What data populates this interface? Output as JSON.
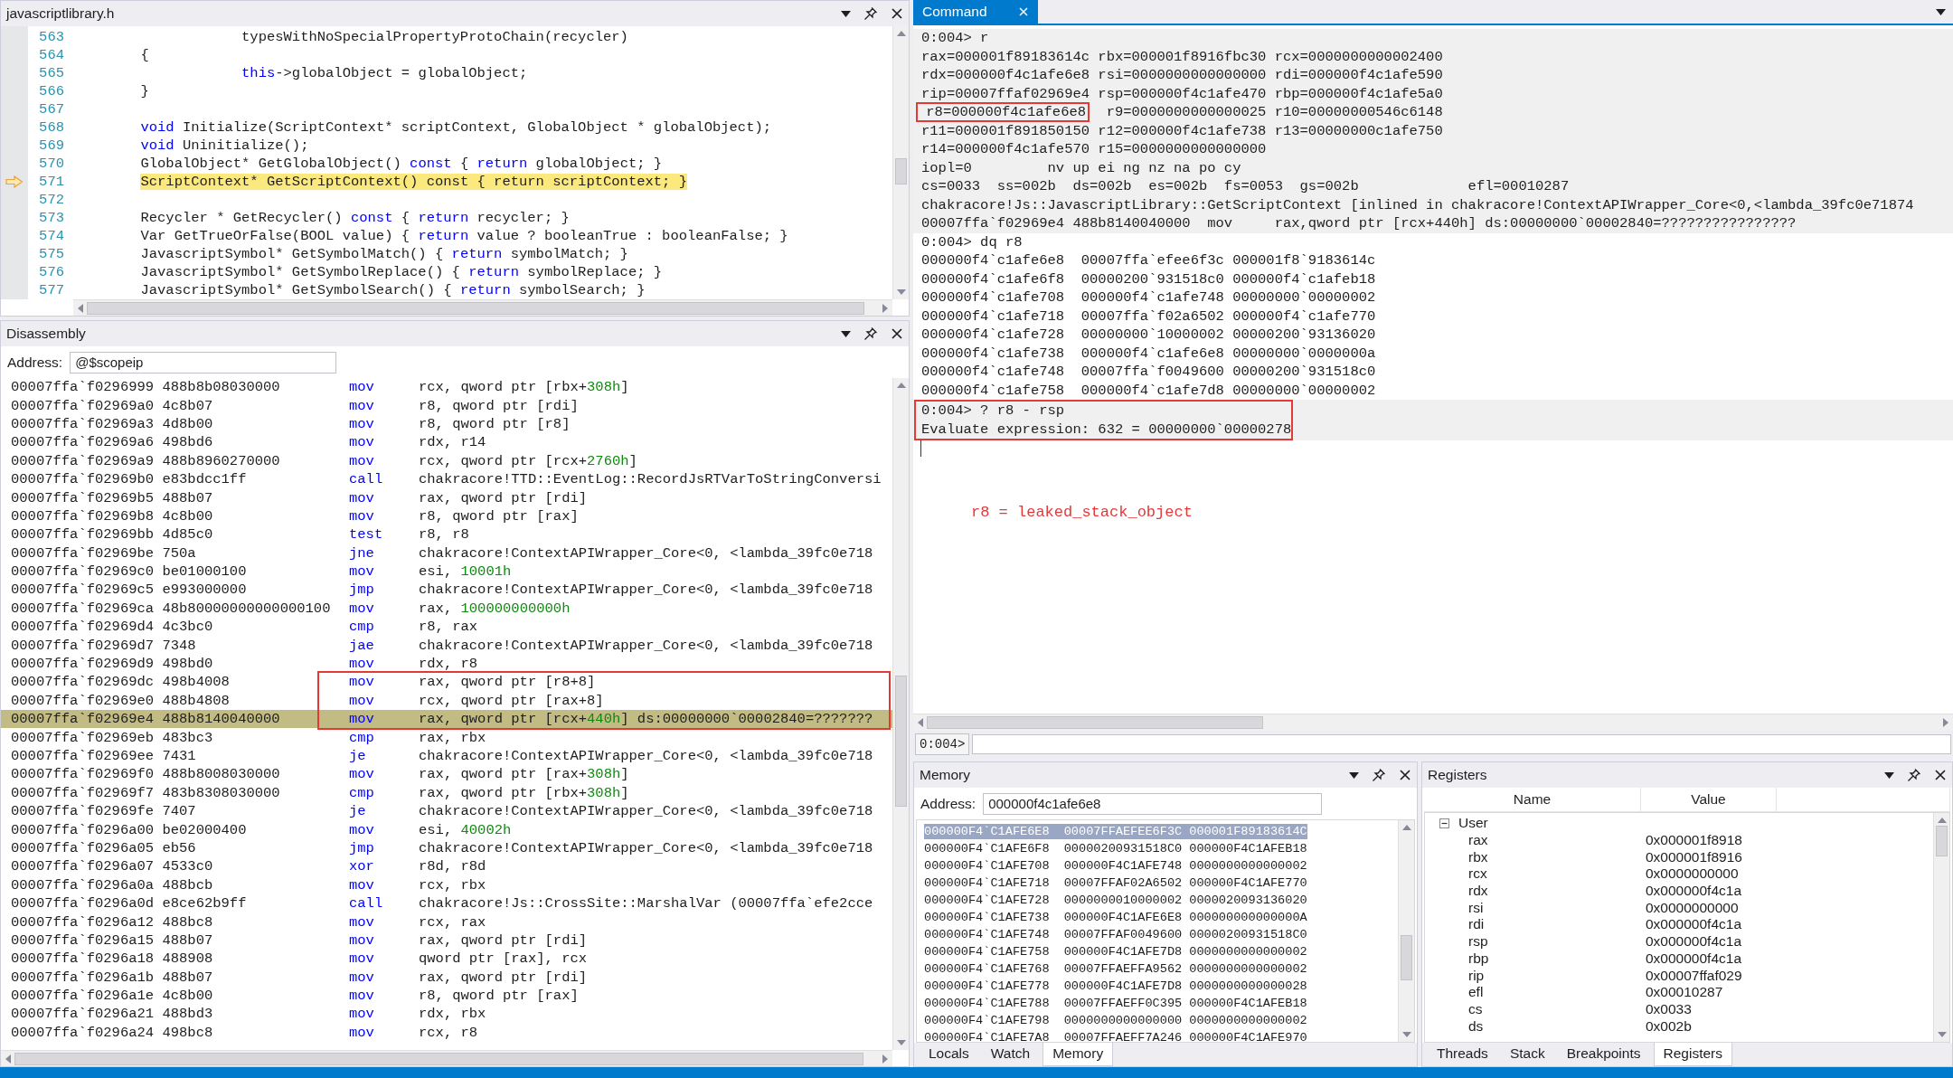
{
  "source": {
    "title": "javascriptlibrary.h",
    "lines": [
      {
        "number": "563",
        "current": false,
        "segments": [
          {
            "text": "                    typesWithNoSpecialPropertyProtoChain(recycler)",
            "kind": "plain"
          }
        ]
      },
      {
        "number": "564",
        "current": false,
        "segments": [
          {
            "text": "        {",
            "kind": "plain"
          }
        ]
      },
      {
        "number": "565",
        "current": false,
        "segments": [
          {
            "text": "                    this",
            "kind": "keyword"
          },
          {
            "text": "->globalObject = globalObject;",
            "kind": "plain"
          }
        ]
      },
      {
        "number": "566",
        "current": false,
        "segments": [
          {
            "text": "        }",
            "kind": "plain"
          }
        ]
      },
      {
        "number": "567",
        "current": false
      },
      {
        "number": "568",
        "current": false,
        "segments": [
          {
            "text": "        void",
            "kind": "keyword"
          },
          {
            "text": " Initialize(ScriptContext* scriptContext, GlobalObject * globalObject);",
            "kind": "plain"
          }
        ]
      },
      {
        "number": "569",
        "current": false,
        "segments": [
          {
            "text": "        void",
            "kind": "keyword"
          },
          {
            "text": " Uninitialize();",
            "kind": "plain"
          }
        ]
      },
      {
        "number": "570",
        "current": false,
        "segments": [
          {
            "text": "        GlobalObject* GetGlobalObject() ",
            "kind": "plain"
          },
          {
            "text": "const",
            "kind": "keyword"
          },
          {
            "text": " { ",
            "kind": "plain"
          },
          {
            "text": "return",
            "kind": "keyword"
          },
          {
            "text": " globalObject; }",
            "kind": "plain"
          }
        ]
      },
      {
        "number": "571",
        "current": true,
        "segments": [
          {
            "text": "        ScriptContext* GetScriptContext() const { return scriptContext; }",
            "kind": "plain"
          }
        ]
      },
      {
        "number": "572",
        "current": false
      },
      {
        "number": "573",
        "current": false,
        "segments": [
          {
            "text": "        Recycler * GetRecycler() ",
            "kind": "plain"
          },
          {
            "text": "const",
            "kind": "keyword"
          },
          {
            "text": " { ",
            "kind": "plain"
          },
          {
            "text": "return",
            "kind": "keyword"
          },
          {
            "text": " recycler; }",
            "kind": "plain"
          }
        ]
      },
      {
        "number": "574",
        "current": false,
        "segments": [
          {
            "text": "        Var GetTrueOrFalse(BOOL value) { ",
            "kind": "plain"
          },
          {
            "text": "return",
            "kind": "keyword"
          },
          {
            "text": " value ? booleanTrue : booleanFalse; }",
            "kind": "plain"
          }
        ]
      },
      {
        "number": "575",
        "current": false,
        "segments": [
          {
            "text": "        JavascriptSymbol* GetSymbolMatch() { ",
            "kind": "plain"
          },
          {
            "text": "return",
            "kind": "keyword"
          },
          {
            "text": " symbolMatch; }",
            "kind": "plain"
          }
        ]
      },
      {
        "number": "576",
        "current": false,
        "segments": [
          {
            "text": "        JavascriptSymbol* GetSymbolReplace() { ",
            "kind": "plain"
          },
          {
            "text": "return",
            "kind": "keyword"
          },
          {
            "text": " symbolReplace; }",
            "kind": "plain"
          }
        ]
      },
      {
        "number": "577",
        "current": false,
        "segments": [
          {
            "text": "        JavascriptSymbol* GetSymbolSearch() { ",
            "kind": "plain"
          },
          {
            "text": "return",
            "kind": "keyword"
          },
          {
            "text": " symbolSearch; }",
            "kind": "plain"
          }
        ]
      }
    ]
  },
  "disassembly": {
    "title": "Disassembly",
    "address_label": "Address:",
    "address": "@$scopeip",
    "rows": [
      {
        "address": "00007ffa`f0296999",
        "bytes": "488b8b08030000",
        "mnemonic": "mov",
        "operands": [
          {
            "text": "rcx, qword ptr [rbx+",
            "kind": "plain"
          },
          {
            "text": "308h",
            "kind": "number"
          },
          {
            "text": "]",
            "kind": "plain"
          }
        ],
        "current": false,
        "boxed": false
      },
      {
        "address": "00007ffa`f02969a0",
        "bytes": "4c8b07",
        "mnemonic": "mov",
        "operands": [
          {
            "text": "r8, qword ptr [rdi]",
            "kind": "plain"
          }
        ],
        "current": false,
        "boxed": false
      },
      {
        "address": "00007ffa`f02969a3",
        "bytes": "4d8b00",
        "mnemonic": "mov",
        "operands": [
          {
            "text": "r8, qword ptr [r8]",
            "kind": "plain"
          }
        ],
        "current": false,
        "boxed": false
      },
      {
        "address": "00007ffa`f02969a6",
        "bytes": "498bd6",
        "mnemonic": "mov",
        "operands": [
          {
            "text": "rdx, r14",
            "kind": "plain"
          }
        ],
        "current": false,
        "boxed": false
      },
      {
        "address": "00007ffa`f02969a9",
        "bytes": "488b8960270000",
        "mnemonic": "mov",
        "operands": [
          {
            "text": "rcx, qword ptr [rcx+",
            "kind": "plain"
          },
          {
            "text": "2760h",
            "kind": "number"
          },
          {
            "text": "]",
            "kind": "plain"
          }
        ],
        "current": false,
        "boxed": false
      },
      {
        "address": "00007ffa`f02969b0",
        "bytes": "e83bdcc1ff",
        "mnemonic": "call",
        "operands": [
          {
            "text": "chakracore!TTD::EventLog::RecordJsRTVarToStringConversi",
            "kind": "plain"
          }
        ],
        "current": false,
        "boxed": false
      },
      {
        "address": "00007ffa`f02969b5",
        "bytes": "488b07",
        "mnemonic": "mov",
        "operands": [
          {
            "text": "rax, qword ptr [rdi]",
            "kind": "plain"
          }
        ],
        "current": false,
        "boxed": false
      },
      {
        "address": "00007ffa`f02969b8",
        "bytes": "4c8b00",
        "mnemonic": "mov",
        "operands": [
          {
            "text": "r8, qword ptr [rax]",
            "kind": "plain"
          }
        ],
        "current": false,
        "boxed": false
      },
      {
        "address": "00007ffa`f02969bb",
        "bytes": "4d85c0",
        "mnemonic": "test",
        "operands": [
          {
            "text": "r8, r8",
            "kind": "plain"
          }
        ],
        "current": false,
        "boxed": false
      },
      {
        "address": "00007ffa`f02969be",
        "bytes": "750a",
        "mnemonic": "jne",
        "operands": [
          {
            "text": "chakracore!ContextAPIWrapper_Core<0, <lambda_39fc0e718",
            "kind": "plain"
          }
        ],
        "current": false,
        "boxed": false
      },
      {
        "address": "00007ffa`f02969c0",
        "bytes": "be01000100",
        "mnemonic": "mov",
        "operands": [
          {
            "text": "esi, ",
            "kind": "plain"
          },
          {
            "text": "10001h",
            "kind": "number"
          }
        ],
        "current": false,
        "boxed": false
      },
      {
        "address": "00007ffa`f02969c5",
        "bytes": "e993000000",
        "mnemonic": "jmp",
        "operands": [
          {
            "text": "chakracore!ContextAPIWrapper_Core<0, <lambda_39fc0e718",
            "kind": "plain"
          }
        ],
        "current": false,
        "boxed": false
      },
      {
        "address": "00007ffa`f02969ca",
        "bytes": "48b80000000000000100",
        "mnemonic": "mov",
        "operands": [
          {
            "text": "rax, ",
            "kind": "plain"
          },
          {
            "text": "100000000000h",
            "kind": "number"
          }
        ],
        "current": false,
        "boxed": false
      },
      {
        "address": "00007ffa`f02969d4",
        "bytes": "4c3bc0",
        "mnemonic": "cmp",
        "operands": [
          {
            "text": "r8, rax",
            "kind": "plain"
          }
        ],
        "current": false,
        "boxed": false
      },
      {
        "address": "00007ffa`f02969d7",
        "bytes": "7348",
        "mnemonic": "jae",
        "operands": [
          {
            "text": "chakracore!ContextAPIWrapper_Core<0, <lambda_39fc0e718",
            "kind": "plain"
          }
        ],
        "current": false,
        "boxed": false
      },
      {
        "address": "00007ffa`f02969d9",
        "bytes": "498bd0",
        "mnemonic": "mov",
        "operands": [
          {
            "text": "rdx, r8",
            "kind": "plain"
          }
        ],
        "current": false,
        "boxed": false
      },
      {
        "address": "00007ffa`f02969dc",
        "bytes": "498b4008",
        "mnemonic": "mov",
        "operands": [
          {
            "text": "rax, qword ptr [r8+8]",
            "kind": "plain"
          }
        ],
        "current": false,
        "boxed": true
      },
      {
        "address": "00007ffa`f02969e0",
        "bytes": "488b4808",
        "mnemonic": "mov",
        "operands": [
          {
            "text": "rcx, qword ptr [rax+8]",
            "kind": "plain"
          }
        ],
        "current": false,
        "boxed": true
      },
      {
        "address": "00007ffa`f02969e4",
        "bytes": "488b8140040000",
        "mnemonic": "mov",
        "operands": [
          {
            "text": "rax, qword ptr [rcx+",
            "kind": "plain"
          },
          {
            "text": "440h",
            "kind": "number"
          },
          {
            "text": "] ds:00000000`00002840=???????",
            "kind": "plain"
          }
        ],
        "current": true,
        "boxed": true
      },
      {
        "address": "00007ffa`f02969eb",
        "bytes": "483bc3",
        "mnemonic": "cmp",
        "operands": [
          {
            "text": "rax, rbx",
            "kind": "plain"
          }
        ],
        "current": false,
        "boxed": false
      },
      {
        "address": "00007ffa`f02969ee",
        "bytes": "7431",
        "mnemonic": "je",
        "operands": [
          {
            "text": "chakracore!ContextAPIWrapper_Core<0, <lambda_39fc0e718",
            "kind": "plain"
          }
        ],
        "current": false,
        "boxed": false
      },
      {
        "address": "00007ffa`f02969f0",
        "bytes": "488b8008030000",
        "mnemonic": "mov",
        "operands": [
          {
            "text": "rax, qword ptr [rax+",
            "kind": "plain"
          },
          {
            "text": "308h",
            "kind": "number"
          },
          {
            "text": "]",
            "kind": "plain"
          }
        ],
        "current": false,
        "boxed": false
      },
      {
        "address": "00007ffa`f02969f7",
        "bytes": "483b8308030000",
        "mnemonic": "cmp",
        "operands": [
          {
            "text": "rax, qword ptr [rbx+",
            "kind": "plain"
          },
          {
            "text": "308h",
            "kind": "number"
          },
          {
            "text": "]",
            "kind": "plain"
          }
        ],
        "current": false,
        "boxed": false
      },
      {
        "address": "00007ffa`f02969fe",
        "bytes": "7407",
        "mnemonic": "je",
        "operands": [
          {
            "text": "chakracore!ContextAPIWrapper_Core<0, <lambda_39fc0e718",
            "kind": "plain"
          }
        ],
        "current": false,
        "boxed": false
      },
      {
        "address": "00007ffa`f0296a00",
        "bytes": "be02000400",
        "mnemonic": "mov",
        "operands": [
          {
            "text": "esi, ",
            "kind": "plain"
          },
          {
            "text": "40002h",
            "kind": "number"
          }
        ],
        "current": false,
        "boxed": false
      },
      {
        "address": "00007ffa`f0296a05",
        "bytes": "eb56",
        "mnemonic": "jmp",
        "operands": [
          {
            "text": "chakracore!ContextAPIWrapper_Core<0, <lambda_39fc0e718",
            "kind": "plain"
          }
        ],
        "current": false,
        "boxed": false
      },
      {
        "address": "00007ffa`f0296a07",
        "bytes": "4533c0",
        "mnemonic": "xor",
        "operands": [
          {
            "text": "r8d, r8d",
            "kind": "plain"
          }
        ],
        "current": false,
        "boxed": false
      },
      {
        "address": "00007ffa`f0296a0a",
        "bytes": "488bcb",
        "mnemonic": "mov",
        "operands": [
          {
            "text": "rcx, rbx",
            "kind": "plain"
          }
        ],
        "current": false,
        "boxed": false
      },
      {
        "address": "00007ffa`f0296a0d",
        "bytes": "e8ce62b9ff",
        "mnemonic": "call",
        "operands": [
          {
            "text": "chakracore!Js::CrossSite::MarshalVar (00007ffa`efe2cce",
            "kind": "plain"
          }
        ],
        "current": false,
        "boxed": false
      },
      {
        "address": "00007ffa`f0296a12",
        "bytes": "488bc8",
        "mnemonic": "mov",
        "operands": [
          {
            "text": "rcx, rax",
            "kind": "plain"
          }
        ],
        "current": false,
        "boxed": false
      },
      {
        "address": "00007ffa`f0296a15",
        "bytes": "488b07",
        "mnemonic": "mov",
        "operands": [
          {
            "text": "rax, qword ptr [rdi]",
            "kind": "plain"
          }
        ],
        "current": false,
        "boxed": false
      },
      {
        "address": "00007ffa`f0296a18",
        "bytes": "488908",
        "mnemonic": "mov",
        "operands": [
          {
            "text": "qword ptr [rax], rcx",
            "kind": "plain"
          }
        ],
        "current": false,
        "boxed": false
      },
      {
        "address": "00007ffa`f0296a1b",
        "bytes": "488b07",
        "mnemonic": "mov",
        "operands": [
          {
            "text": "rax, qword ptr [rdi]",
            "kind": "plain"
          }
        ],
        "current": false,
        "boxed": false
      },
      {
        "address": "00007ffa`f0296a1e",
        "bytes": "4c8b00",
        "mnemonic": "mov",
        "operands": [
          {
            "text": "r8, qword ptr [rax]",
            "kind": "plain"
          }
        ],
        "current": false,
        "boxed": false
      },
      {
        "address": "00007ffa`f0296a21",
        "bytes": "488bd3",
        "mnemonic": "mov",
        "operands": [
          {
            "text": "rdx, rbx",
            "kind": "plain"
          }
        ],
        "current": false,
        "boxed": false
      },
      {
        "address": "00007ffa`f0296a24",
        "bytes": "498bc8",
        "mnemonic": "mov",
        "operands": [
          {
            "text": "rcx, r8",
            "kind": "plain"
          }
        ],
        "current": false,
        "boxed": false
      }
    ]
  },
  "command": {
    "tab": {
      "label": "Command",
      "selected": true
    },
    "blocks": [
      {
        "shaded": true,
        "boxed": false,
        "lines": [
          {
            "text": "0:004> r"
          },
          {
            "text": "rax=000001f89183614c rbx=000001f8916fbc30 rcx=0000000000002400"
          },
          {
            "text": "rdx=000000f4c1afe6e8 rsi=0000000000000000 rdi=000000f4c1afe590"
          },
          {
            "text": "rip=00007ffaf02969e4 rsp=000000f4c1afe470 rbp=000000f4c1afe5a0"
          },
          {
            "boxed": " r8=000000f4c1afe6e8",
            "text": "  r9=0000000000000025 r10=00000000546c6148"
          },
          {
            "text": "r11=000001f891850150 r12=000000f4c1afe738 r13=00000000c1afe750"
          },
          {
            "text": "r14=000000f4c1afe570 r15=0000000000000000"
          },
          {
            "text": "iopl=0         nv up ei ng nz na po cy"
          },
          {
            "text": "cs=0033  ss=002b  ds=002b  es=002b  fs=0053  gs=002b             efl=00010287"
          },
          {
            "text": "chakracore!Js::JavascriptLibrary::GetScriptContext [inlined in chakracore!ContextAPIWrapper_Core<0,<lambda_39fc0e71874"
          },
          {
            "text": "00007ffa`f02969e4 488b8140040000  mov     rax,qword ptr [rcx+440h] ds:00000000`00002840=????????????????"
          }
        ]
      },
      {
        "shaded": false,
        "boxed": false,
        "lines": [
          {
            "text": "0:004> dq r8"
          },
          {
            "text": "000000f4`c1afe6e8  00007ffa`efee6f3c 000001f8`9183614c"
          },
          {
            "text": "000000f4`c1afe6f8  00000200`931518c0 000000f4`c1afeb18"
          },
          {
            "text": "000000f4`c1afe708  000000f4`c1afe748 00000000`00000002"
          },
          {
            "text": "000000f4`c1afe718  00007ffa`f02a6502 000000f4`c1afe770"
          },
          {
            "text": "000000f4`c1afe728  00000000`10000002 00000200`93136020"
          },
          {
            "text": "000000f4`c1afe738  000000f4`c1afe6e8 00000000`0000000a"
          },
          {
            "text": "000000f4`c1afe748  00007ffa`f0049600 00000200`931518c0"
          },
          {
            "text": "000000f4`c1afe758  000000f4`c1afe7d8 00000000`00000002"
          }
        ]
      },
      {
        "shaded": true,
        "boxed": true,
        "lines": [
          {
            "text": "0:004> ? r8 - rsp"
          },
          {
            "text": "Evaluate expression: 632 = 00000000`00000278"
          }
        ]
      }
    ],
    "note": "r8 = leaked_stack_object",
    "prompt": "0:004>"
  },
  "memory": {
    "title": "Memory",
    "address_label": "Address:",
    "address": "000000f4c1afe6e8",
    "rows": [
      {
        "address": "000000F4`C1AFE6E8",
        "col_1": "00007FFAEFEE6F3C",
        "col_2": "000001F89183614C",
        "selected": true
      },
      {
        "address": "000000F4`C1AFE6F8",
        "col_1": "00000200931518C0",
        "col_2": "000000F4C1AFEB18",
        "selected": false
      },
      {
        "address": "000000F4`C1AFE708",
        "col_1": "000000F4C1AFE748",
        "col_2": "0000000000000002",
        "selected": false
      },
      {
        "address": "000000F4`C1AFE718",
        "col_1": "00007FFAF02A6502",
        "col_2": "000000F4C1AFE770",
        "selected": false
      },
      {
        "address": "000000F4`C1AFE728",
        "col_1": "0000000010000002",
        "col_2": "0000020093136020",
        "selected": false
      },
      {
        "address": "000000F4`C1AFE738",
        "col_1": "000000F4C1AFE6E8",
        "col_2": "000000000000000A",
        "selected": false
      },
      {
        "address": "000000F4`C1AFE748",
        "col_1": "00007FFAF0049600",
        "col_2": "00000200931518C0",
        "selected": false
      },
      {
        "address": "000000F4`C1AFE758",
        "col_1": "000000F4C1AFE7D8",
        "col_2": "0000000000000002",
        "selected": false
      },
      {
        "address": "000000F4`C1AFE768",
        "col_1": "00007FFAEFFA9562",
        "col_2": "0000000000000002",
        "selected": false
      },
      {
        "address": "000000F4`C1AFE778",
        "col_1": "000000F4C1AFE7D8",
        "col_2": "0000000000000028",
        "selected": false
      },
      {
        "address": "000000F4`C1AFE788",
        "col_1": "00007FFAEFF0C395",
        "col_2": "000000F4C1AFEB18",
        "selected": false
      },
      {
        "address": "000000F4`C1AFE798",
        "col_1": "0000000000000000",
        "col_2": "0000000000000002",
        "selected": false
      },
      {
        "address": "000000F4`C1AFE7A8",
        "col_1": "00007FFAEFF7A246",
        "col_2": "000000F4C1AFE970",
        "selected": false
      }
    ],
    "tabs": [
      {
        "label": "Locals",
        "selected": false
      },
      {
        "label": "Watch",
        "selected": false
      },
      {
        "label": "Memory",
        "selected": true
      }
    ]
  },
  "registers": {
    "title": "Registers",
    "columns": [
      "Name",
      "Value"
    ],
    "group": {
      "label": "User",
      "expanded": true,
      "children": [
        {
          "name": "rax",
          "value": "0x000001f8918"
        },
        {
          "name": "rbx",
          "value": "0x000001f8916"
        },
        {
          "name": "rcx",
          "value": "0x0000000000"
        },
        {
          "name": "rdx",
          "value": "0x000000f4c1a"
        },
        {
          "name": "rsi",
          "value": "0x0000000000"
        },
        {
          "name": "rdi",
          "value": "0x000000f4c1a"
        },
        {
          "name": "rsp",
          "value": "0x000000f4c1a"
        },
        {
          "name": "rbp",
          "value": "0x000000f4c1a"
        },
        {
          "name": "rip",
          "value": "0x00007ffaf029"
        },
        {
          "name": "efl",
          "value": "0x00010287"
        },
        {
          "name": "cs",
          "value": "0x0033"
        },
        {
          "name": "ds",
          "value": "0x002b"
        }
      ]
    },
    "tabs": [
      {
        "label": "Threads",
        "selected": false
      },
      {
        "label": "Stack",
        "selected": false
      },
      {
        "label": "Breakpoints",
        "selected": false
      },
      {
        "label": "Registers",
        "selected": true
      }
    ]
  }
}
